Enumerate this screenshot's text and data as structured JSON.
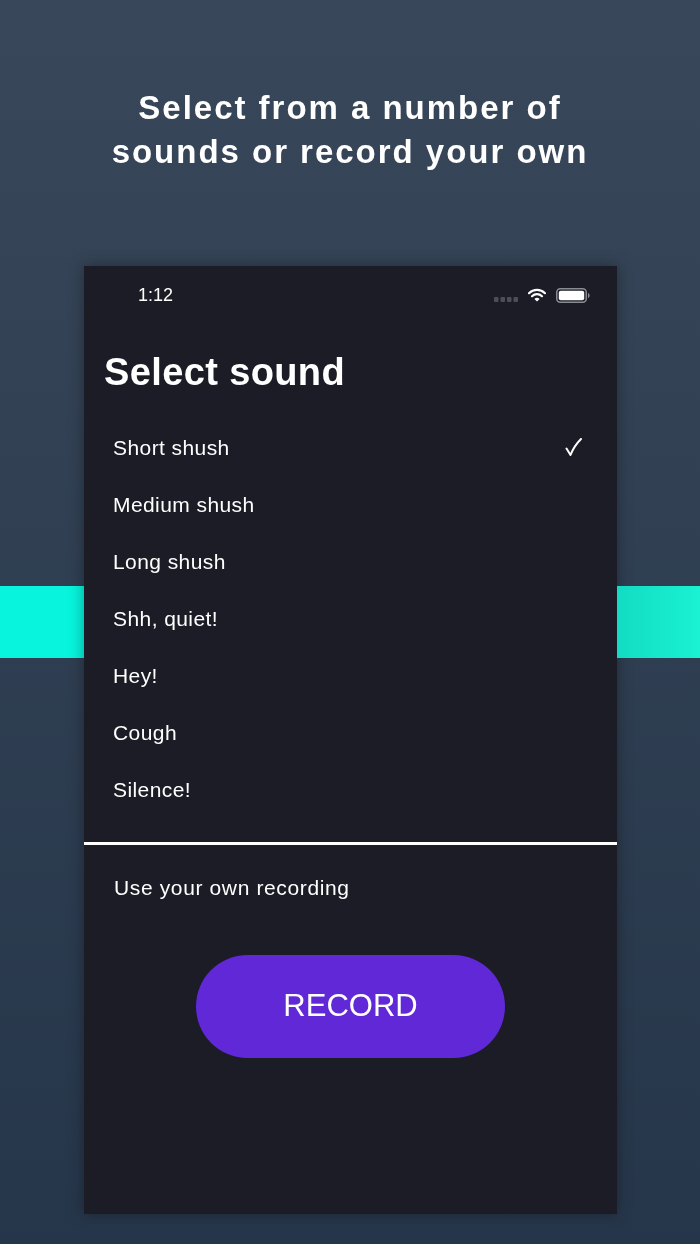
{
  "headline": "Select from a number of sounds or record your own",
  "status_bar": {
    "time": "1:12"
  },
  "screen": {
    "title": "Select sound",
    "sounds": [
      {
        "label": "Short shush",
        "selected": true
      },
      {
        "label": "Medium shush",
        "selected": false
      },
      {
        "label": "Long shush",
        "selected": false
      },
      {
        "label": "Shh, quiet!",
        "selected": false
      },
      {
        "label": "Hey!",
        "selected": false
      },
      {
        "label": "Cough",
        "selected": false
      },
      {
        "label": "Silence!",
        "selected": false
      }
    ],
    "custom": {
      "label": "Use your own recording",
      "button": "RECORD"
    }
  }
}
